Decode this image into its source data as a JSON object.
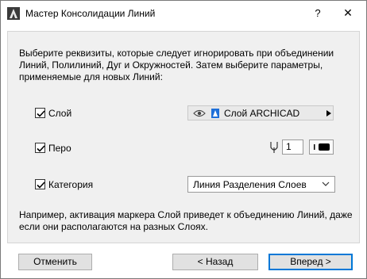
{
  "window": {
    "title": "Мастер Консолидации Линий",
    "help_label": "?",
    "close_label": "✕"
  },
  "intro_text": "Выберите реквизиты, которые следует игнорировать при объединении Линий, Полилиний, Дуг и Окружностей. Затем выберите параметры, применяемые для новых Линий:",
  "options": {
    "layer": {
      "label": "Слой",
      "checked": true
    },
    "pen": {
      "label": "Перо",
      "checked": true
    },
    "category": {
      "label": "Категория",
      "checked": true
    }
  },
  "layer_select": {
    "value": "Слой ARCHICAD",
    "icons": [
      "eye-icon",
      "layer-icon",
      "triangle-right-icon"
    ]
  },
  "pen_field": {
    "value": "1",
    "icon": "pen-icon"
  },
  "category_select": {
    "value": "Линия Разделения Слоев",
    "icon": "chevron-down-icon"
  },
  "note_text": "Например, активация маркера Слой приведет к объединению Линий, даже если они располагаются на разных Слоях.",
  "buttons": {
    "cancel": "Отменить",
    "back": "< Назад",
    "next": "Вперед >"
  },
  "colors": {
    "accent": "#0078d7",
    "panel": "#f0f0f0",
    "layer_icon": "#1e6fd9"
  }
}
